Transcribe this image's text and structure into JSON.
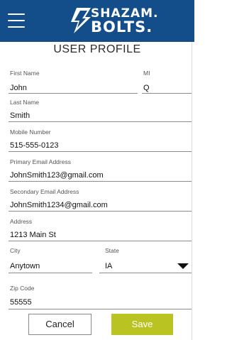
{
  "header": {
    "menu_icon": "hamburger-menu-icon",
    "logo_line1": "SHAZAM.",
    "logo_line2": "BOLTS.",
    "logo_icon": "lightning-bolt-logo-icon",
    "background": "#134d8a"
  },
  "page_title": "USER PROFILE",
  "form": {
    "first_name": {
      "label": "First Name",
      "value": "John"
    },
    "mi": {
      "label": "MI",
      "value": "Q"
    },
    "last_name": {
      "label": "Last Name",
      "value": "Smith"
    },
    "mobile_number": {
      "label": "Mobile Number",
      "value": "515-555-0123"
    },
    "primary_email": {
      "label": "Primary Email Address",
      "value": "JohnSmith123@gmail.com"
    },
    "secondary_email": {
      "label": "Secondary Email Address",
      "value": "JohnSmith1234@gmail.com"
    },
    "address": {
      "label": "Address",
      "value": "1213 Main St"
    },
    "city": {
      "label": "City",
      "value": "Anytown"
    },
    "state": {
      "label": "State",
      "value": "IA",
      "dropdown_icon": "triangle-down-icon"
    },
    "zip": {
      "label": "Zip Code",
      "value": "55555"
    }
  },
  "buttons": {
    "cancel_label": "Cancel",
    "save_label": "Save",
    "save_color": "#b9c322"
  }
}
